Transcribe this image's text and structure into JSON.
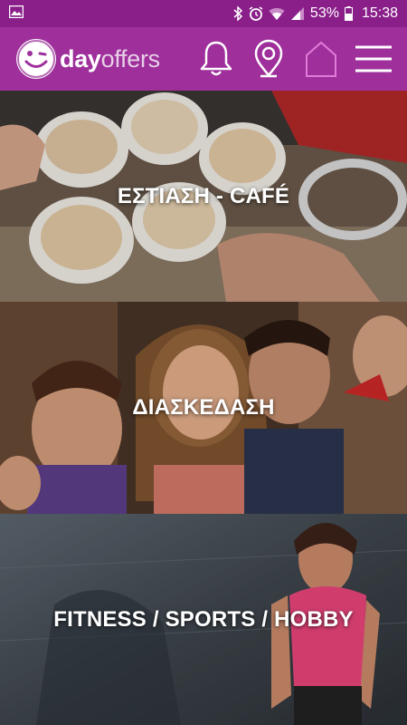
{
  "status_bar": {
    "battery_percent": "53%",
    "time": "15:38",
    "icons": [
      "image-icon",
      "bluetooth-icon",
      "alarm-icon",
      "wifi-icon",
      "cell-signal-icon",
      "battery-icon"
    ]
  },
  "header": {
    "logo_bold": "day",
    "logo_light": "offers",
    "icons": [
      "bell-icon",
      "location-pin-icon",
      "home-icon",
      "menu-icon"
    ],
    "brand_color": "#9e2f9b",
    "status_color": "#8a1f8a"
  },
  "categories": [
    {
      "label": "ΕΣΤΙΑΣΗ - CAFÉ"
    },
    {
      "label": "ΔΙΑΣΚΕΔΑΣΗ"
    },
    {
      "label": "FITNESS / SPORTS / HOBBY"
    }
  ]
}
